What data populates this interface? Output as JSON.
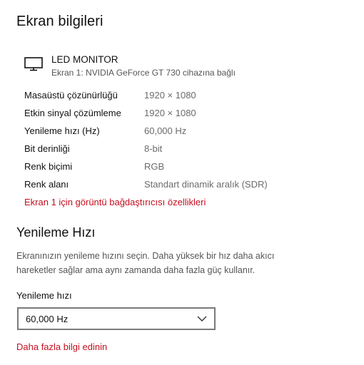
{
  "section_title": "Ekran bilgileri",
  "display": {
    "icon": "monitor-icon",
    "name": "LED MONITOR",
    "subtitle": "Ekran 1: NVIDIA GeForce GT 730 cihazına bağlı"
  },
  "info": [
    {
      "label": "Masaüstü çözünürlüğü",
      "value": "1920 × 1080"
    },
    {
      "label": "Etkin sinyal çözümleme",
      "value": "1920 × 1080"
    },
    {
      "label": "Yenileme hızı (Hz)",
      "value": "60,000 Hz"
    },
    {
      "label": "Bit derinliği",
      "value": "8-bit"
    },
    {
      "label": "Renk biçimi",
      "value": "RGB"
    },
    {
      "label": "Renk alanı",
      "value": "Standart dinamik aralık (SDR)"
    }
  ],
  "adapter_link": "Ekran 1 için görüntü bağdaştırıcısı özellikleri",
  "refresh_section": {
    "title": "Yenileme Hızı",
    "description": "Ekranınızın yenileme hızını seçin. Daha yüksek bir hız daha akıcı hareketler sağlar ama aynı zamanda daha fazla güç kullanır.",
    "field_label": "Yenileme hızı",
    "selected_value": "60,000 Hz",
    "more_info_link": "Daha fazla bilgi edinin"
  },
  "colors": {
    "link": "#c50f1f",
    "secondary_text": "#6b6b6b"
  }
}
